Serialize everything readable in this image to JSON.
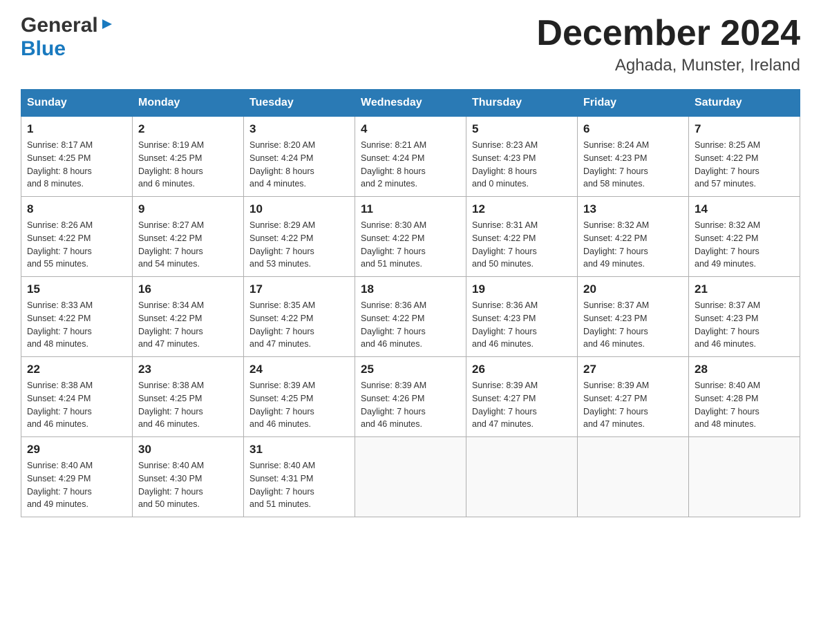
{
  "header": {
    "month_title": "December 2024",
    "subtitle": "Aghada, Munster, Ireland",
    "logo_general": "General",
    "logo_blue": "Blue"
  },
  "columns": [
    "Sunday",
    "Monday",
    "Tuesday",
    "Wednesday",
    "Thursday",
    "Friday",
    "Saturday"
  ],
  "weeks": [
    [
      {
        "day": "1",
        "sunrise": "Sunrise: 8:17 AM",
        "sunset": "Sunset: 4:25 PM",
        "daylight1": "Daylight: 8 hours",
        "daylight2": "and 8 minutes."
      },
      {
        "day": "2",
        "sunrise": "Sunrise: 8:19 AM",
        "sunset": "Sunset: 4:25 PM",
        "daylight1": "Daylight: 8 hours",
        "daylight2": "and 6 minutes."
      },
      {
        "day": "3",
        "sunrise": "Sunrise: 8:20 AM",
        "sunset": "Sunset: 4:24 PM",
        "daylight1": "Daylight: 8 hours",
        "daylight2": "and 4 minutes."
      },
      {
        "day": "4",
        "sunrise": "Sunrise: 8:21 AM",
        "sunset": "Sunset: 4:24 PM",
        "daylight1": "Daylight: 8 hours",
        "daylight2": "and 2 minutes."
      },
      {
        "day": "5",
        "sunrise": "Sunrise: 8:23 AM",
        "sunset": "Sunset: 4:23 PM",
        "daylight1": "Daylight: 8 hours",
        "daylight2": "and 0 minutes."
      },
      {
        "day": "6",
        "sunrise": "Sunrise: 8:24 AM",
        "sunset": "Sunset: 4:23 PM",
        "daylight1": "Daylight: 7 hours",
        "daylight2": "and 58 minutes."
      },
      {
        "day": "7",
        "sunrise": "Sunrise: 8:25 AM",
        "sunset": "Sunset: 4:22 PM",
        "daylight1": "Daylight: 7 hours",
        "daylight2": "and 57 minutes."
      }
    ],
    [
      {
        "day": "8",
        "sunrise": "Sunrise: 8:26 AM",
        "sunset": "Sunset: 4:22 PM",
        "daylight1": "Daylight: 7 hours",
        "daylight2": "and 55 minutes."
      },
      {
        "day": "9",
        "sunrise": "Sunrise: 8:27 AM",
        "sunset": "Sunset: 4:22 PM",
        "daylight1": "Daylight: 7 hours",
        "daylight2": "and 54 minutes."
      },
      {
        "day": "10",
        "sunrise": "Sunrise: 8:29 AM",
        "sunset": "Sunset: 4:22 PM",
        "daylight1": "Daylight: 7 hours",
        "daylight2": "and 53 minutes."
      },
      {
        "day": "11",
        "sunrise": "Sunrise: 8:30 AM",
        "sunset": "Sunset: 4:22 PM",
        "daylight1": "Daylight: 7 hours",
        "daylight2": "and 51 minutes."
      },
      {
        "day": "12",
        "sunrise": "Sunrise: 8:31 AM",
        "sunset": "Sunset: 4:22 PM",
        "daylight1": "Daylight: 7 hours",
        "daylight2": "and 50 minutes."
      },
      {
        "day": "13",
        "sunrise": "Sunrise: 8:32 AM",
        "sunset": "Sunset: 4:22 PM",
        "daylight1": "Daylight: 7 hours",
        "daylight2": "and 49 minutes."
      },
      {
        "day": "14",
        "sunrise": "Sunrise: 8:32 AM",
        "sunset": "Sunset: 4:22 PM",
        "daylight1": "Daylight: 7 hours",
        "daylight2": "and 49 minutes."
      }
    ],
    [
      {
        "day": "15",
        "sunrise": "Sunrise: 8:33 AM",
        "sunset": "Sunset: 4:22 PM",
        "daylight1": "Daylight: 7 hours",
        "daylight2": "and 48 minutes."
      },
      {
        "day": "16",
        "sunrise": "Sunrise: 8:34 AM",
        "sunset": "Sunset: 4:22 PM",
        "daylight1": "Daylight: 7 hours",
        "daylight2": "and 47 minutes."
      },
      {
        "day": "17",
        "sunrise": "Sunrise: 8:35 AM",
        "sunset": "Sunset: 4:22 PM",
        "daylight1": "Daylight: 7 hours",
        "daylight2": "and 47 minutes."
      },
      {
        "day": "18",
        "sunrise": "Sunrise: 8:36 AM",
        "sunset": "Sunset: 4:22 PM",
        "daylight1": "Daylight: 7 hours",
        "daylight2": "and 46 minutes."
      },
      {
        "day": "19",
        "sunrise": "Sunrise: 8:36 AM",
        "sunset": "Sunset: 4:23 PM",
        "daylight1": "Daylight: 7 hours",
        "daylight2": "and 46 minutes."
      },
      {
        "day": "20",
        "sunrise": "Sunrise: 8:37 AM",
        "sunset": "Sunset: 4:23 PM",
        "daylight1": "Daylight: 7 hours",
        "daylight2": "and 46 minutes."
      },
      {
        "day": "21",
        "sunrise": "Sunrise: 8:37 AM",
        "sunset": "Sunset: 4:23 PM",
        "daylight1": "Daylight: 7 hours",
        "daylight2": "and 46 minutes."
      }
    ],
    [
      {
        "day": "22",
        "sunrise": "Sunrise: 8:38 AM",
        "sunset": "Sunset: 4:24 PM",
        "daylight1": "Daylight: 7 hours",
        "daylight2": "and 46 minutes."
      },
      {
        "day": "23",
        "sunrise": "Sunrise: 8:38 AM",
        "sunset": "Sunset: 4:25 PM",
        "daylight1": "Daylight: 7 hours",
        "daylight2": "and 46 minutes."
      },
      {
        "day": "24",
        "sunrise": "Sunrise: 8:39 AM",
        "sunset": "Sunset: 4:25 PM",
        "daylight1": "Daylight: 7 hours",
        "daylight2": "and 46 minutes."
      },
      {
        "day": "25",
        "sunrise": "Sunrise: 8:39 AM",
        "sunset": "Sunset: 4:26 PM",
        "daylight1": "Daylight: 7 hours",
        "daylight2": "and 46 minutes."
      },
      {
        "day": "26",
        "sunrise": "Sunrise: 8:39 AM",
        "sunset": "Sunset: 4:27 PM",
        "daylight1": "Daylight: 7 hours",
        "daylight2": "and 47 minutes."
      },
      {
        "day": "27",
        "sunrise": "Sunrise: 8:39 AM",
        "sunset": "Sunset: 4:27 PM",
        "daylight1": "Daylight: 7 hours",
        "daylight2": "and 47 minutes."
      },
      {
        "day": "28",
        "sunrise": "Sunrise: 8:40 AM",
        "sunset": "Sunset: 4:28 PM",
        "daylight1": "Daylight: 7 hours",
        "daylight2": "and 48 minutes."
      }
    ],
    [
      {
        "day": "29",
        "sunrise": "Sunrise: 8:40 AM",
        "sunset": "Sunset: 4:29 PM",
        "daylight1": "Daylight: 7 hours",
        "daylight2": "and 49 minutes."
      },
      {
        "day": "30",
        "sunrise": "Sunrise: 8:40 AM",
        "sunset": "Sunset: 4:30 PM",
        "daylight1": "Daylight: 7 hours",
        "daylight2": "and 50 minutes."
      },
      {
        "day": "31",
        "sunrise": "Sunrise: 8:40 AM",
        "sunset": "Sunset: 4:31 PM",
        "daylight1": "Daylight: 7 hours",
        "daylight2": "and 51 minutes."
      },
      null,
      null,
      null,
      null
    ]
  ]
}
